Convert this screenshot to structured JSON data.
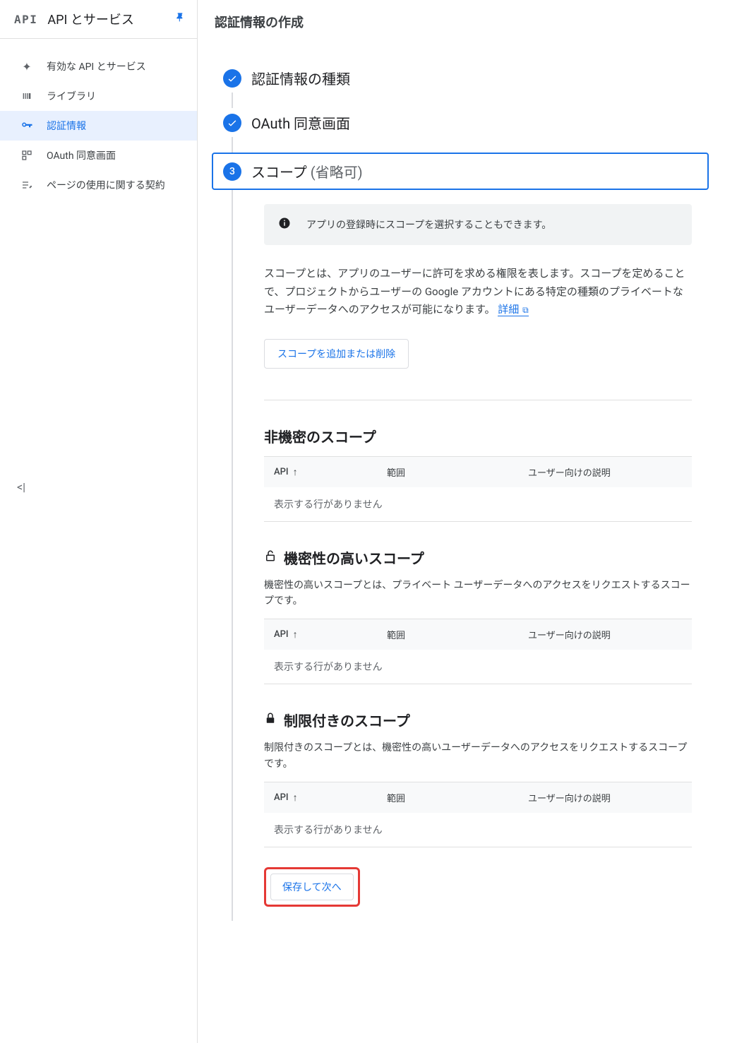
{
  "sidebar": {
    "logo": "API",
    "title": "API とサービス",
    "items": [
      {
        "label": "有効な API とサービス"
      },
      {
        "label": "ライブラリ"
      },
      {
        "label": "認証情報"
      },
      {
        "label": "OAuth 同意画面"
      },
      {
        "label": "ページの使用に関する契約"
      }
    ]
  },
  "page": {
    "title": "認証情報の作成"
  },
  "steps": {
    "step1": "認証情報の種類",
    "step2": "OAuth 同意画面",
    "step3_num": "3",
    "step3_label": "スコープ",
    "step3_sub": "(省略可)"
  },
  "banner": {
    "text": "アプリの登録時にスコープを選択することもできます。"
  },
  "desc": {
    "text": "スコープとは、アプリのユーザーに許可を求める権限を表します。スコープを定めることで、プロジェクトからユーザーの Google アカウントにある特定の種類のプライベートなユーザーデータへのアクセスが可能になります。",
    "link": "詳細"
  },
  "buttons": {
    "add_remove": "スコープを追加または削除",
    "save_next": "保存して次へ"
  },
  "sections": {
    "nonsensitive": {
      "title": "非機密のスコープ"
    },
    "sensitive": {
      "title": "機密性の高いスコープ",
      "desc": "機密性の高いスコープとは、プライベート ユーザーデータへのアクセスをリクエストするスコープです。"
    },
    "restricted": {
      "title": "制限付きのスコープ",
      "desc": "制限付きのスコープとは、機密性の高いユーザーデータへのアクセスをリクエストするスコープです。"
    }
  },
  "table": {
    "col_api": "API",
    "col_scope": "範囲",
    "col_desc": "ユーザー向けの説明",
    "empty": "表示する行がありません"
  }
}
